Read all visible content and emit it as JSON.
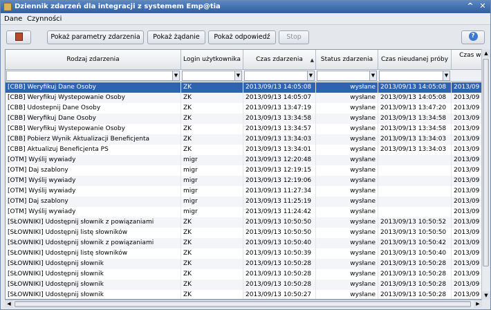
{
  "window": {
    "title": "Dziennik zdarzeń dla integracji z systemem Emp@tia"
  },
  "menu": {
    "items": [
      "Dane",
      "Czynności"
    ]
  },
  "toolbar": {
    "show_params": "Pokaż parametry zdarzenia",
    "show_request": "Pokaż żądanie",
    "show_response": "Pokaż odpowiedź",
    "stop": "Stop",
    "help": "?"
  },
  "table": {
    "columns": [
      "Rodzaj zdarzenia",
      "Login użytkownika",
      "Czas zdarzenia",
      "Status zdarzenia",
      "Czas nieudanej próby",
      "Czas wy"
    ],
    "rows": [
      [
        "[CBB] Weryfikuj Dane Osoby",
        "ZK",
        "2013/09/13 14:05:08",
        "wysłane",
        "2013/09/13 14:05:08",
        "2013/09"
      ],
      [
        "[CBB] Weryfikuj Wystepowanie Osoby",
        "ZK",
        "2013/09/13 14:05:07",
        "wysłane",
        "2013/09/13 14:05:08",
        "2013/09"
      ],
      [
        "[CBB] Udostepnij Dane Osoby",
        "ZK",
        "2013/09/13 13:47:19",
        "wysłane",
        "2013/09/13 13:47:20",
        "2013/09"
      ],
      [
        "[CBB] Weryfikuj Dane Osoby",
        "ZK",
        "2013/09/13 13:34:58",
        "wysłane",
        "2013/09/13 13:34:58",
        "2013/09"
      ],
      [
        "[CBB] Weryfikuj Wystepowanie Osoby",
        "ZK",
        "2013/09/13 13:34:57",
        "wysłane",
        "2013/09/13 13:34:58",
        "2013/09"
      ],
      [
        "[CBB] Pobierz Wynik Aktualizacji Beneficjenta",
        "ZK",
        "2013/09/13 13:34:03",
        "wysłane",
        "2013/09/13 13:34:03",
        "2013/09"
      ],
      [
        "[CBB] Aktualizuj Beneficjenta PS",
        "ZK",
        "2013/09/13 13:34:01",
        "wysłane",
        "2013/09/13 13:34:03",
        "2013/09"
      ],
      [
        "[OTM] Wyślij wywiady",
        "migr",
        "2013/09/13 12:20:48",
        "wysłane",
        "",
        "2013/09"
      ],
      [
        "[OTM] Daj szablony",
        "migr",
        "2013/09/13 12:19:15",
        "wysłane",
        "",
        "2013/09"
      ],
      [
        "[OTM] Wyślij wywiady",
        "migr",
        "2013/09/13 12:19:06",
        "wysłane",
        "",
        "2013/09"
      ],
      [
        "[OTM] Wyślij wywiady",
        "migr",
        "2013/09/13 11:27:34",
        "wysłane",
        "",
        "2013/09"
      ],
      [
        "[OTM] Daj szablony",
        "migr",
        "2013/09/13 11:25:19",
        "wysłane",
        "",
        "2013/09"
      ],
      [
        "[OTM] Wyślij wywiady",
        "migr",
        "2013/09/13 11:24:42",
        "wysłane",
        "",
        "2013/09"
      ],
      [
        "[SŁOWNIKI] Udostępnij słownik z powiązaniami",
        "ZK",
        "2013/09/13 10:50:50",
        "wysłane",
        "2013/09/13 10:50:52",
        "2013/09"
      ],
      [
        "[SŁOWNIKI] Udostępnij listę słowników",
        "ZK",
        "2013/09/13 10:50:50",
        "wysłane",
        "2013/09/13 10:50:50",
        "2013/09"
      ],
      [
        "[SŁOWNIKI] Udostępnij słownik z powiązaniami",
        "ZK",
        "2013/09/13 10:50:40",
        "wysłane",
        "2013/09/13 10:50:42",
        "2013/09"
      ],
      [
        "[SŁOWNIKI] Udostępnij listę słowników",
        "ZK",
        "2013/09/13 10:50:39",
        "wysłane",
        "2013/09/13 10:50:40",
        "2013/09"
      ],
      [
        "[SŁOWNIKI] Udostępnij słownik",
        "ZK",
        "2013/09/13 10:50:28",
        "wysłane",
        "2013/09/13 10:50:28",
        "2013/09"
      ],
      [
        "[SŁOWNIKI] Udostępnij słownik",
        "ZK",
        "2013/09/13 10:50:28",
        "wysłane",
        "2013/09/13 10:50:28",
        "2013/09"
      ],
      [
        "[SŁOWNIKI] Udostępnij słownik",
        "ZK",
        "2013/09/13 10:50:28",
        "wysłane",
        "2013/09/13 10:50:28",
        "2013/09"
      ],
      [
        "[SŁOWNIKI] Udostępnij słownik",
        "ZK",
        "2013/09/13 10:50:27",
        "wysłane",
        "2013/09/13 10:50:28",
        "2013/09"
      ]
    ]
  }
}
